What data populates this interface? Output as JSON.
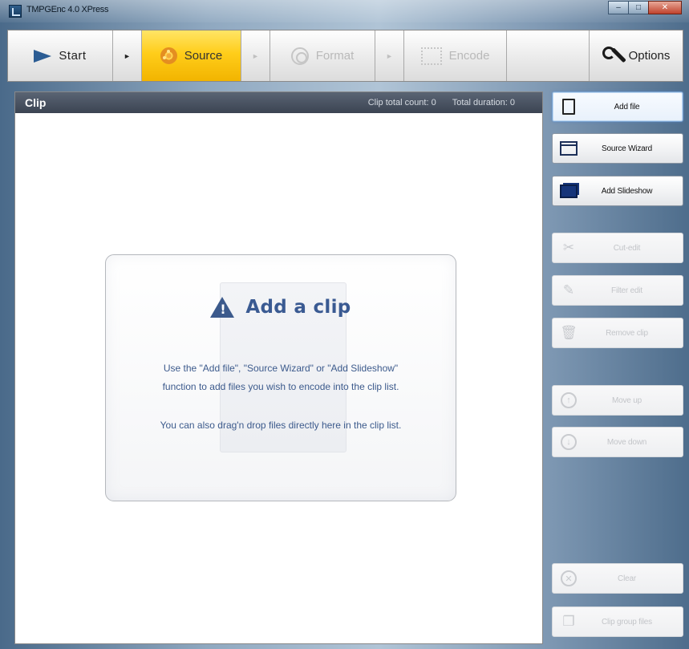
{
  "window": {
    "title": "TMPGEnc 4.0 XPress",
    "controls": {
      "minimize": "–",
      "maximize": "□",
      "close": "✕"
    }
  },
  "toolbar": {
    "start_label": "Start",
    "source_label": "Source",
    "format_label": "Format",
    "encode_label": "Encode",
    "options_label": "Options",
    "arrow_glyph": "►"
  },
  "clip_panel": {
    "title": "Clip",
    "total_count_label": "Clip total count: 0",
    "total_duration_label": "Total duration: 0"
  },
  "empty_state": {
    "heading": "Add a clip",
    "line1": "Use the \"Add file\", \"Source Wizard\" or \"Add Slideshow\"",
    "line2": "function to add files you wish to encode into the clip list.",
    "line3": "You can also drag'n drop files directly here in the clip list."
  },
  "sidebar": {
    "add_file": "Add file",
    "source_wizard": "Source Wizard",
    "add_slideshow": "Add Slideshow",
    "cut_edit": "Cut-edit",
    "filter_edit": "Filter edit",
    "remove_clip": "Remove clip",
    "move_up": "Move up",
    "move_down": "Move down",
    "clear": "Clear",
    "clip_group_files": "Clip group files"
  },
  "colors": {
    "source_active": "#ffcd1a",
    "clip_header": "#3b4452",
    "heading_blue": "#3a5a92",
    "start_arrow": "#2b5c93"
  }
}
